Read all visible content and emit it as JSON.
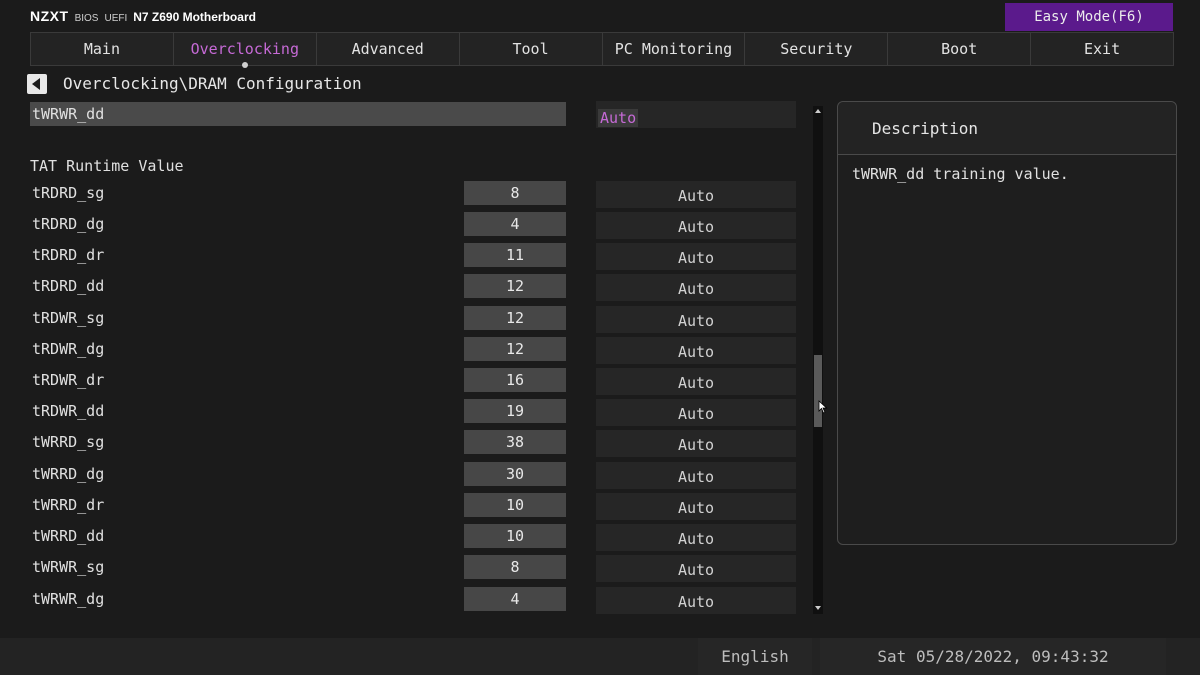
{
  "header": {
    "brand": "NZXT",
    "bios_label": "BIOS",
    "uefi_label": "UEFI",
    "model": "N7 Z690 Motherboard",
    "easy_mode": "Easy Mode(F6)"
  },
  "tabs": [
    {
      "label": "Main",
      "active": false
    },
    {
      "label": "Overclocking",
      "active": true
    },
    {
      "label": "Advanced",
      "active": false
    },
    {
      "label": "Tool",
      "active": false
    },
    {
      "label": "PC Monitoring",
      "active": false
    },
    {
      "label": "Security",
      "active": false
    },
    {
      "label": "Boot",
      "active": false
    },
    {
      "label": "Exit",
      "active": false
    }
  ],
  "breadcrumb": "Overclocking\\DRAM Configuration",
  "selected_item": {
    "label": "tWRWR_dd",
    "option": "Auto"
  },
  "section_title": "TAT Runtime Value",
  "rows": [
    {
      "label": "tRDRD_sg",
      "value": "8",
      "option": "Auto"
    },
    {
      "label": "tRDRD_dg",
      "value": "4",
      "option": "Auto"
    },
    {
      "label": "tRDRD_dr",
      "value": "11",
      "option": "Auto"
    },
    {
      "label": "tRDRD_dd",
      "value": "12",
      "option": "Auto"
    },
    {
      "label": "tRDWR_sg",
      "value": "12",
      "option": "Auto"
    },
    {
      "label": "tRDWR_dg",
      "value": "12",
      "option": "Auto"
    },
    {
      "label": "tRDWR_dr",
      "value": "16",
      "option": "Auto"
    },
    {
      "label": "tRDWR_dd",
      "value": "19",
      "option": "Auto"
    },
    {
      "label": "tWRRD_sg",
      "value": "38",
      "option": "Auto"
    },
    {
      "label": "tWRRD_dg",
      "value": "30",
      "option": "Auto"
    },
    {
      "label": "tWRRD_dr",
      "value": "10",
      "option": "Auto"
    },
    {
      "label": "tWRRD_dd",
      "value": "10",
      "option": "Auto"
    },
    {
      "label": "tWRWR_sg",
      "value": "8",
      "option": "Auto"
    },
    {
      "label": "tWRWR_dg",
      "value": "4",
      "option": "Auto"
    }
  ],
  "description": {
    "title": "Description",
    "text": "tWRWR_dd training value."
  },
  "footer": {
    "language": "English",
    "datetime": "Sat 05/28/2022, 09:43:32"
  },
  "colors": {
    "accent": "#c66ad6",
    "easy_mode_bg": "#5b1a8c",
    "background": "#1b1b1b"
  }
}
